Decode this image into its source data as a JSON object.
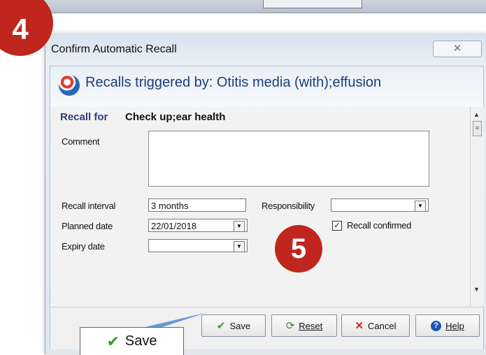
{
  "badges": {
    "step4": "4",
    "step5": "5"
  },
  "window": {
    "title": "Confirm Automatic Recall",
    "close_icon": "✕"
  },
  "header": {
    "text": "Recalls triggered by: Otitis media (with);effusion"
  },
  "form": {
    "recall_for_label": "Recall for",
    "recall_for_value": "Check up;ear health",
    "comment_label": "Comment",
    "comment_value": "",
    "recall_interval_label": "Recall interval",
    "recall_interval_value": "3 months",
    "responsibility_label": "Responsibility",
    "responsibility_value": "",
    "planned_date_label": "Planned date",
    "planned_date_value": "22/01/2018",
    "expiry_date_label": "Expiry date",
    "expiry_date_value": "",
    "recall_confirmed_label": "Recall confirmed",
    "recall_confirmed_checked": true
  },
  "buttons": {
    "save": "Save",
    "reset": "Reset",
    "cancel": "Cancel",
    "help": "Help"
  },
  "zoom_callout": {
    "save_label": "Save"
  }
}
